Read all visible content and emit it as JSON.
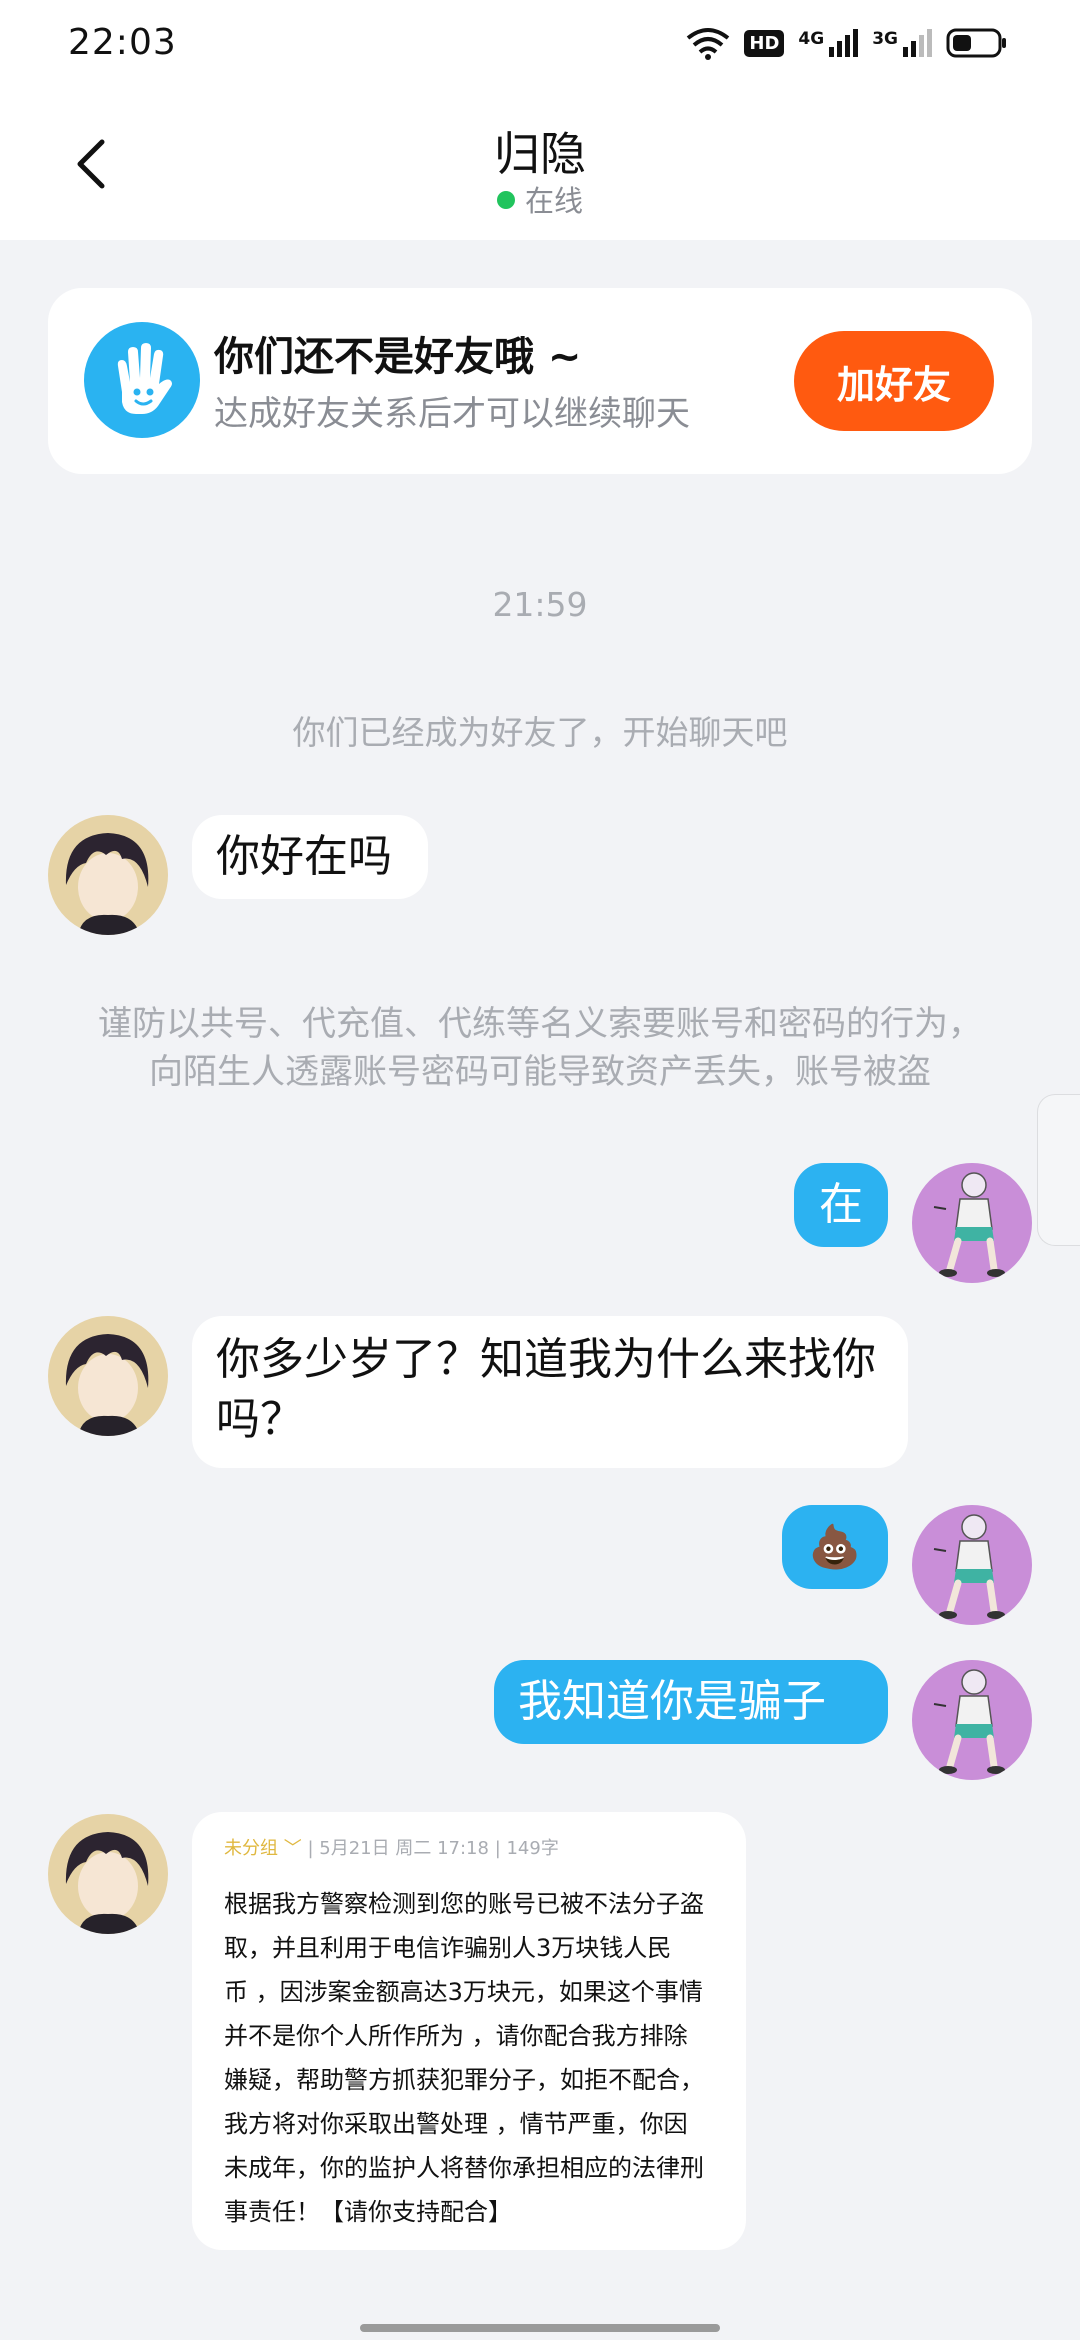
{
  "status_bar": {
    "time": "22:03",
    "hd_label": "HD",
    "net1": "4G",
    "net2": "3G"
  },
  "header": {
    "title": "归隐",
    "status": "在线"
  },
  "friend_card": {
    "title": "你们还不是好友哦 ~",
    "subtitle": "达成好友关系后才可以继续聊天",
    "button": "加好友"
  },
  "chat": {
    "time_label": "21:59",
    "system_notice": "你们已经成为好友了，开始聊天吧",
    "safety_notice": "谨防以共号、代充值、代练等名义索要账号和密码的行为，向陌生人透露账号密码可能导致资产丢失，账号被盗",
    "messages": [
      {
        "from": "other",
        "text": "你好在吗"
      },
      {
        "from": "me",
        "text": "在"
      },
      {
        "from": "other",
        "text": "你多少岁了？知道我为什么来找你吗？"
      },
      {
        "from": "me",
        "text": "💩"
      },
      {
        "from": "me",
        "text": "我知道你是骗子"
      }
    ],
    "note_card": {
      "group": "未分组",
      "date": "5月21日 周二 17:18",
      "count": "149字",
      "lines": [
        "根据我方警察检测到您的账号已被不法分子盗",
        "取，并且利用于电信诈骗别人3万块钱人民",
        "币 ，因涉案金额高达3万块元，如果这个事情",
        "并不是你个人所作所为 ，请你配合我方排除",
        "嫌疑，帮助警方抓获犯罪分子，如拒不配合，",
        "我方将对你采取出警处理 ，情节严重，你因",
        "未成年，你的监护人将替你承担相应的法律刑",
        "事责任！【请你支持配合】"
      ]
    }
  }
}
